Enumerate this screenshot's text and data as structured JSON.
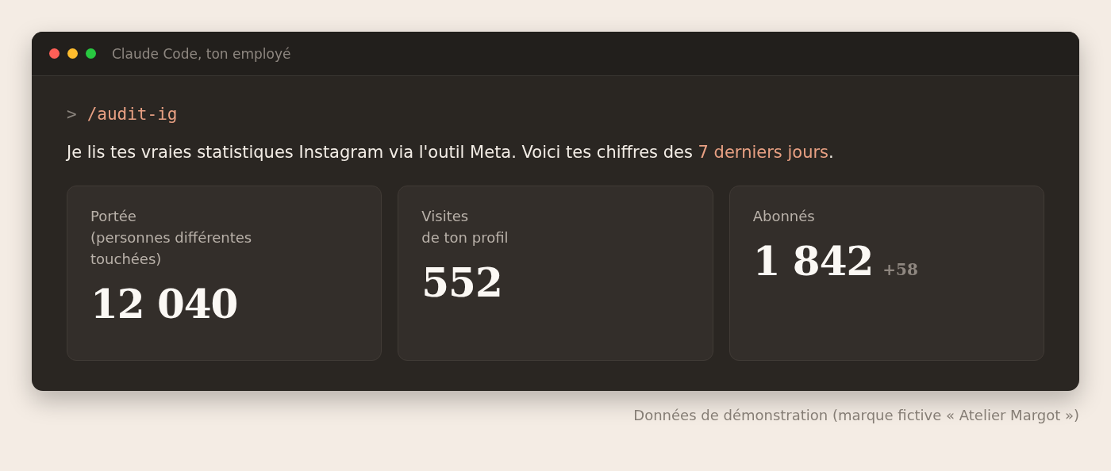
{
  "window": {
    "title": "Claude Code, ton employé"
  },
  "command": {
    "prompt": ">",
    "text": "/audit-ig"
  },
  "message": {
    "before": "Je lis tes vraies statistiques Instagram via l'outil Meta. Voici tes chiffres des ",
    "highlight": "7 derniers jours",
    "after": "."
  },
  "cards": [
    {
      "label": "Portée\n(personnes différentes\ntouchées)",
      "value": "12 040"
    },
    {
      "label": "Visites\nde ton profil",
      "value": "552"
    },
    {
      "label": "Abonnés",
      "value": "1 842",
      "delta": "+58"
    }
  ],
  "footnote": "Données de démonstration (marque fictive « Atelier Margot »)"
}
